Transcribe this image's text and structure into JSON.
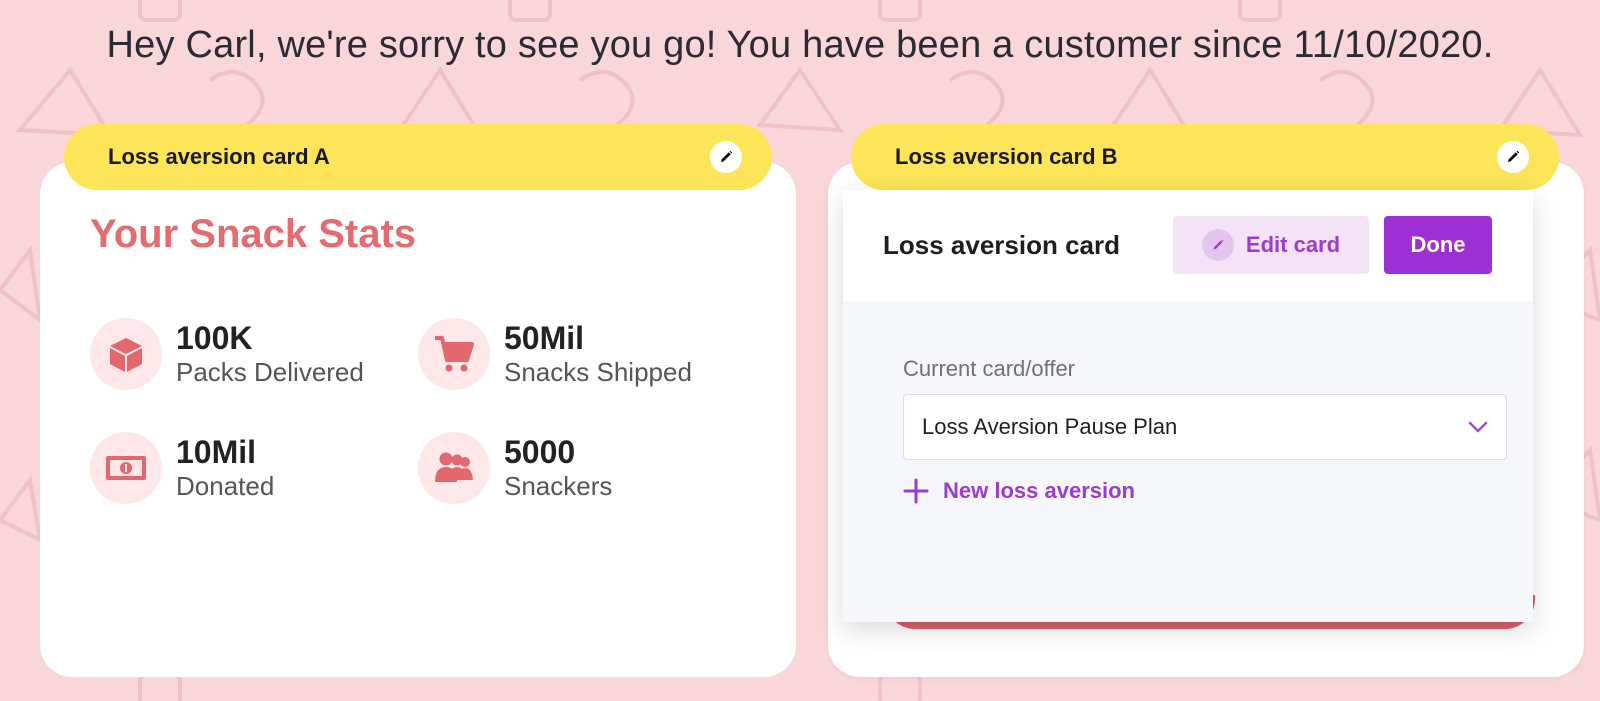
{
  "headline": "Hey Carl, we're sorry to see you go! You have been a customer since 11/10/2020.",
  "card_a": {
    "pill_label": "Loss aversion card A",
    "title": "Your Snack Stats",
    "stats": [
      {
        "value": "100K",
        "label": "Packs Delivered",
        "icon": "box-icon"
      },
      {
        "value": "50Mil",
        "label": "Snacks Shipped",
        "icon": "cart-icon"
      },
      {
        "value": "10Mil",
        "label": "Donated",
        "icon": "cash-icon"
      },
      {
        "value": "5000",
        "label": "Snackers",
        "icon": "people-icon"
      }
    ]
  },
  "card_b": {
    "pill_label": "Loss aversion card B",
    "editor": {
      "title": "Loss aversion card",
      "edit_label": "Edit card",
      "done_label": "Done",
      "field_label": "Current card/offer",
      "selected_value": "Loss Aversion Pause Plan",
      "new_link": "New loss aversion"
    }
  },
  "colors": {
    "background": "#f8d6d9",
    "pill": "#fce558",
    "stat_accent": "#e56b6f",
    "purple": "#9d2fd3"
  }
}
